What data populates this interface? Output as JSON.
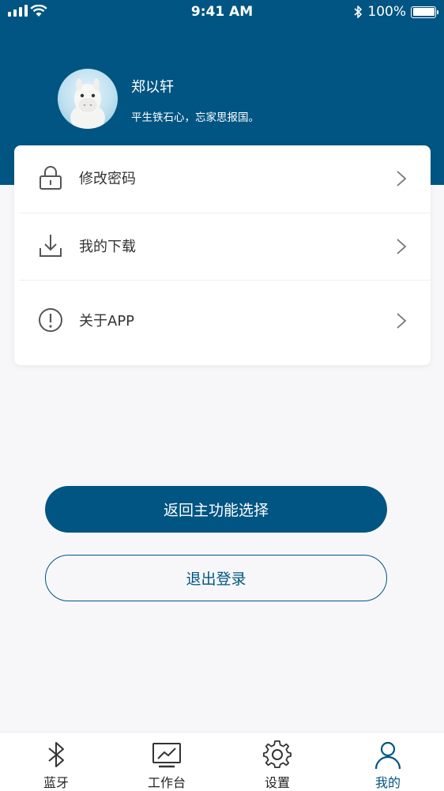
{
  "status_bar": {
    "time": "9:41 AM",
    "battery_text": "100%"
  },
  "profile": {
    "name": "郑以轩",
    "motto": "平生铁石心，忘家思报国。"
  },
  "menu": {
    "items": [
      {
        "label": "修改密码",
        "icon": "lock-icon"
      },
      {
        "label": "我的下载",
        "icon": "download-icon"
      },
      {
        "label": "关于APP",
        "icon": "info-icon"
      }
    ]
  },
  "actions": {
    "primary_label": "返回主功能选择",
    "secondary_label": "退出登录"
  },
  "tabbar": {
    "items": [
      {
        "label": "蓝牙",
        "icon": "bluetooth-icon",
        "active": false
      },
      {
        "label": "工作台",
        "icon": "workbench-icon",
        "active": false
      },
      {
        "label": "设置",
        "icon": "gear-icon",
        "active": false
      },
      {
        "label": "我的",
        "icon": "user-icon",
        "active": true
      }
    ]
  },
  "colors": {
    "brand": "#005582",
    "background": "#f7f7f9"
  }
}
